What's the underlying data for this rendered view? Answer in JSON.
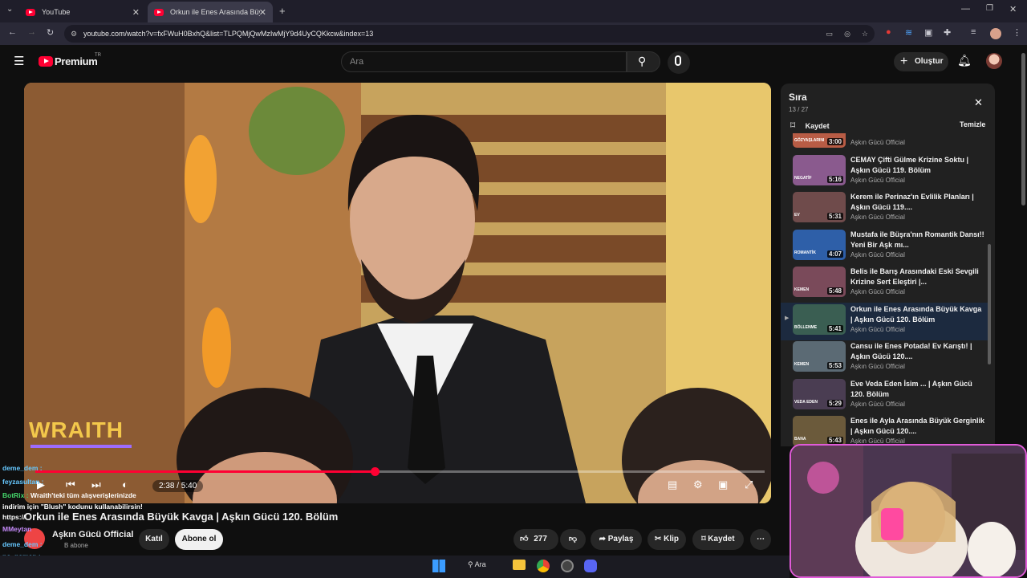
{
  "browser": {
    "tabs": [
      {
        "label": "YouTube"
      },
      {
        "label": "Orkun ile Enes Arasında Büyük K"
      }
    ],
    "url": "youtube.com/watch?v=fxFWuH0BxhQ&list=TLPQMjQwMzIwMjY9d4UyCQKkcw&index=13"
  },
  "header": {
    "logo": "Premium",
    "region": "TR",
    "search_placeholder": "Ara",
    "create_label": "Oluştur"
  },
  "video": {
    "overlay_brand": "WRAITH",
    "time": "2:38 / 5:40",
    "progress": 0.465,
    "title": "Orkun ile Enes Arasında Büyük Kavga | Aşkın Gücü 120. Bölüm",
    "channel": "Aşkın Gücü Official",
    "subscribers": "B abone",
    "join_label": "Katıl",
    "subscribe_label": "Abone ol",
    "likes": "277",
    "share_label": "Paylaş",
    "clip_label": "Klip",
    "save_label": "Kaydet"
  },
  "queue": {
    "title": "Sıra",
    "position": "13 / 27",
    "save_label": "Kaydet",
    "clear_label": "Temizle",
    "items": [
      {
        "duration": "3:00",
        "title": "",
        "channel": "Aşkın Gücü Official",
        "thumb_text": "GÖZYAŞLARINI"
      },
      {
        "duration": "5:16",
        "title": "CEMAY Çifti Gülme Krizine Soktu | Aşkın Gücü 119. Bölüm",
        "channel": "Aşkın Gücü Official",
        "thumb_text": "NEGATİF"
      },
      {
        "duration": "5:31",
        "title": "Kerem ile Perinaz'ın Evlilik Planları | Aşkın Gücü 119....",
        "channel": "Aşkın Gücü Official",
        "thumb_text": "EV"
      },
      {
        "duration": "4:07",
        "title": "Mustafa ile Büşra'nın Romantik Dansı!! Yeni Bir Aşk mı...",
        "channel": "Aşkın Gücü Official",
        "thumb_text": "ROMANTİK"
      },
      {
        "duration": "5:48",
        "title": "Belis ile Barış Arasındaki Eski Sevgili Krizine Sert Eleştiri |...",
        "channel": "Aşkın Gücü Official",
        "thumb_text": "KEMEN"
      },
      {
        "duration": "5:41",
        "title": "Orkun ile Enes Arasında Büyük Kavga | Aşkın Gücü 120. Bölüm",
        "channel": "Aşkın Gücü Official",
        "thumb_text": "BÖLLENME"
      },
      {
        "duration": "5:53",
        "title": "Cansu ile Enes Potada! Ev Karıştı! | Aşkın Gücü 120....",
        "channel": "Aşkın Gücü Official",
        "thumb_text": "KEMEN"
      },
      {
        "duration": "5:29",
        "title": "Eve Veda Eden İsim ... | Aşkın Gücü 120. Bölüm",
        "channel": "Aşkın Gücü Official",
        "thumb_text": "VEDA EDEN"
      },
      {
        "duration": "5:43",
        "title": "Enes ile Ayla Arasında Büyük Gerginlik | Aşkın Gücü 120....",
        "channel": "Aşkın Gücü Official",
        "thumb_text": "BANA"
      }
    ]
  },
  "chat": [
    {
      "user": "deme_dem :",
      "msg": "",
      "color": "#66c8ff"
    },
    {
      "user": "feyzasultan :",
      "msg": "",
      "color": "#66c8ff"
    },
    {
      "user": "BotRix :",
      "msg": "Wraith'teki tüm alışverişlerinizde",
      "color": "#45d66b"
    },
    {
      "user": "",
      "msg": "indirim için \"Blush\" kodunu kullanabilirsin!",
      "color": "#ffffff"
    },
    {
      "user": "",
      "msg": "https://",
      "color": "#8ab4f8"
    },
    {
      "user": "MMeytan",
      "msg": "",
      "color": "#c58af9"
    },
    {
      "user": "deme_dem :",
      "msg": "",
      "color": "#66c8ff"
    },
    {
      "user": "no_namen :",
      "msg": "",
      "color": "#66c8ff"
    },
    {
      "user": "deme_dem :",
      "msg": "",
      "color": "#66c8ff"
    }
  ],
  "taskbar": {
    "search_label": "Ara"
  }
}
